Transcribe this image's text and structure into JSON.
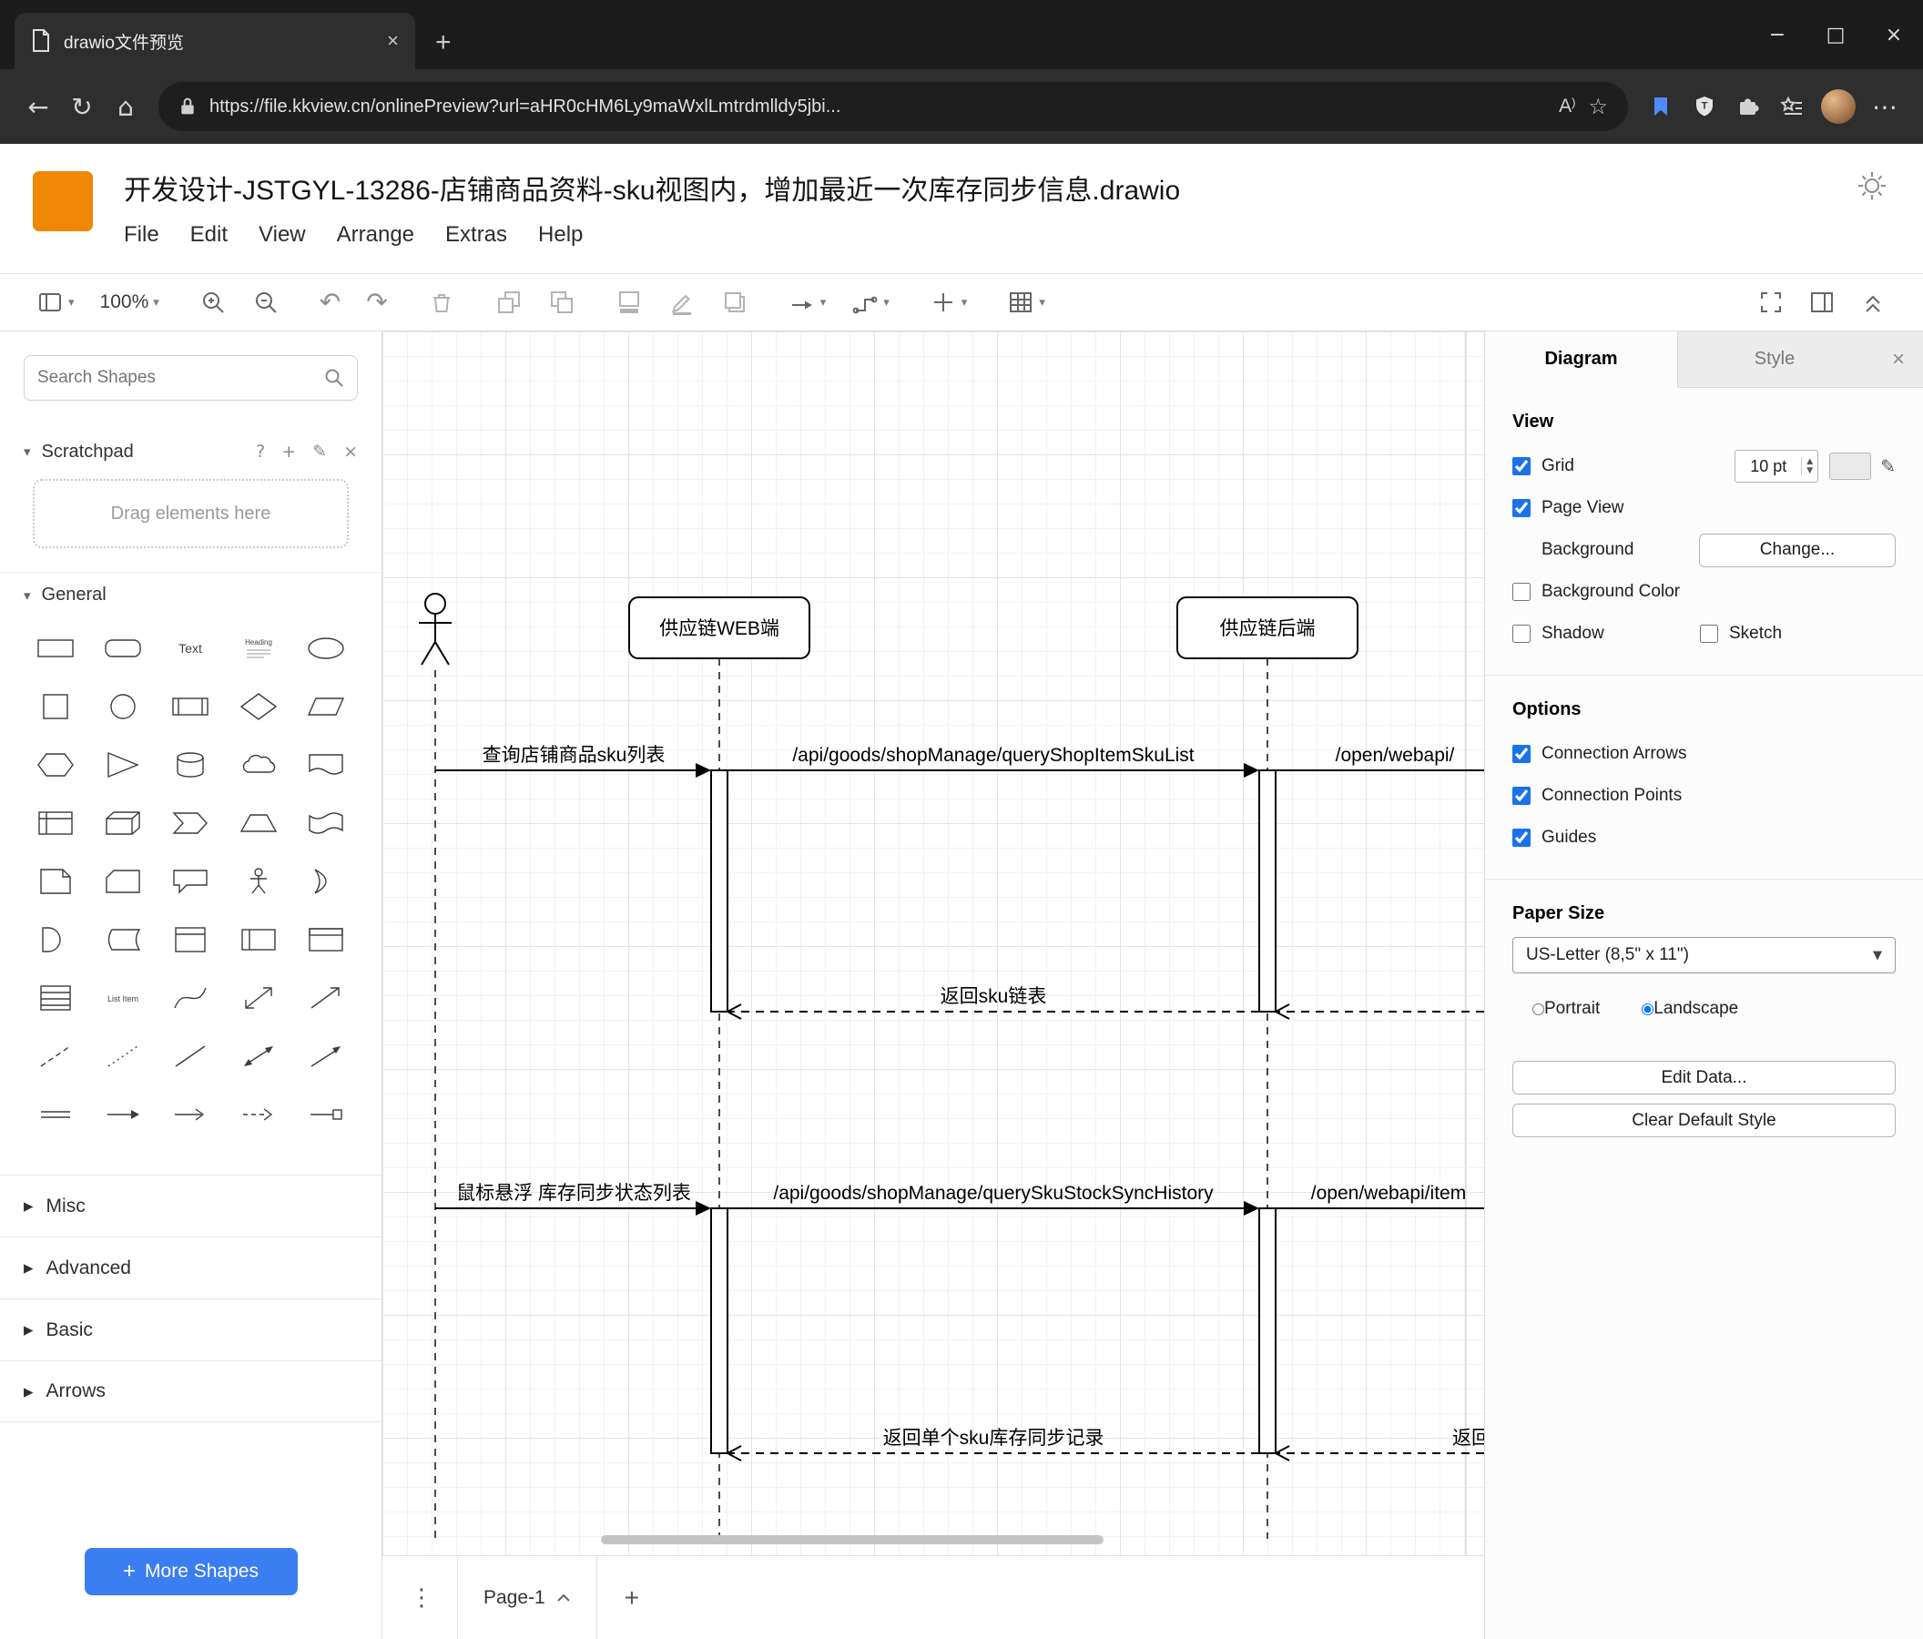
{
  "browser": {
    "tab_title": "drawio文件预览",
    "url": "https://file.kkview.cn/onlinePreview?url=aHR0cHM6Ly9maWxlLmtrdmlldy5jbi...",
    "read_aloud": "A"
  },
  "app": {
    "title": "开发设计-JSTGYL-13286-店铺商品资料-sku视图内，增加最近一次库存同步信息.drawio",
    "menus": [
      "File",
      "Edit",
      "View",
      "Arrange",
      "Extras",
      "Help"
    ],
    "toolbar": {
      "zoom": "100%"
    }
  },
  "sidebar": {
    "search_placeholder": "Search Shapes",
    "scratchpad_label": "Scratchpad",
    "scratchpad_hint": "Drag elements here",
    "general_label": "General",
    "sections": [
      "Misc",
      "Advanced",
      "Basic",
      "Arrows"
    ],
    "more_shapes_label": "More Shapes",
    "shape_labels": {
      "text": "Text",
      "heading": "Heading",
      "list_item": "List Item"
    },
    "general_shapes": [
      "rectangle",
      "rounded-rectangle",
      "text",
      "heading",
      "ellipse",
      "square",
      "circle",
      "process",
      "diamond",
      "parallelogram",
      "hexagon",
      "triangle",
      "cylinder",
      "cloud",
      "document",
      "internal-storage",
      "cube",
      "step",
      "trapezoid",
      "tape",
      "note",
      "card",
      "callout",
      "actor",
      "or",
      "and",
      "data-storage",
      "vertical-container",
      "horizontal-container",
      "container",
      "list",
      "list-item",
      "curve",
      "bidirectional-arrow",
      "arrow",
      "dashed-line",
      "dotted-line",
      "line",
      "bidirectional-connector",
      "directional-connector",
      "link",
      "arrow-right",
      "thin-arrow",
      "dashed-arrow",
      "labeled-arrow"
    ]
  },
  "canvas": {
    "page_label": "Page-1",
    "diagram": {
      "participants": {
        "web": "供应链WEB端",
        "backend": "供应链后端"
      },
      "messages": {
        "query_sku_list": "查询店铺商品sku列表",
        "api_query_shop_item_sku_list": "/api/goods/shopManage/queryShopItemSkuList",
        "open_webapi_top": "/open/webapi/",
        "return_sku_list": "返回sku链表",
        "hover_stock_sync_list": "鼠标悬浮 库存同步状态列表",
        "api_query_sku_stock_sync_history": "/api/goods/shopManage/querySkuStockSyncHistory",
        "open_webapi_bottom": "/open/webapi/item",
        "return_single_sku_record": "返回单个sku库存同步记录",
        "return_clipped": "返回"
      }
    }
  },
  "format_panel": {
    "tabs": {
      "diagram": "Diagram",
      "style": "Style"
    },
    "view": {
      "heading": "View",
      "grid_label": "Grid",
      "grid_size": "10 pt",
      "grid_checked": true,
      "page_view_label": "Page View",
      "page_view_checked": true,
      "background_label": "Background",
      "change_button": "Change...",
      "background_color_label": "Background Color",
      "background_color_checked": false,
      "shadow_label": "Shadow",
      "shadow_checked": false,
      "sketch_label": "Sketch",
      "sketch_checked": false
    },
    "options": {
      "heading": "Options",
      "connection_arrows": "Connection Arrows",
      "connection_arrows_checked": true,
      "connection_points": "Connection Points",
      "connection_points_checked": true,
      "guides": "Guides",
      "guides_checked": true
    },
    "paper": {
      "heading": "Paper Size",
      "size_value": "US-Letter (8,5\" x 11\")",
      "portrait": "Portrait",
      "portrait_checked": false,
      "landscape": "Landscape",
      "landscape_checked": true
    },
    "buttons": {
      "edit_data": "Edit Data...",
      "clear_default_style": "Clear Default Style"
    }
  }
}
